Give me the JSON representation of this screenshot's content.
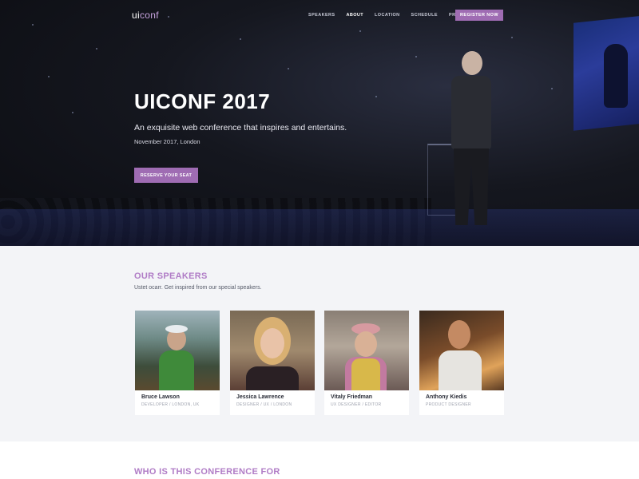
{
  "brand": {
    "prefix": "ui",
    "suffix": "conf"
  },
  "nav": {
    "items": [
      {
        "label": "SPEAKERS",
        "active": false
      },
      {
        "label": "ABOUT",
        "active": true
      },
      {
        "label": "LOCATION",
        "active": false
      },
      {
        "label": "SCHEDULE",
        "active": false
      },
      {
        "label": "PRICING",
        "active": false
      }
    ],
    "register_label": "REGISTER NOW"
  },
  "hero": {
    "title": "UICONF 2017",
    "tagline": "An exquisite web conference that inspires and entertains.",
    "date": "November 2017, London",
    "cta_label": "RESERVE YOUR SEAT"
  },
  "speakers_section": {
    "title": "OUR SPEAKERS",
    "subtitle": "Ustet ocarr. Get inspired from our special speakers.",
    "speakers": [
      {
        "name": "Bruce Lawson",
        "role": "DEVELOPER / LONDON, UK"
      },
      {
        "name": "Jessica Lawrence",
        "role": "DESIGNER / UX / LONDON"
      },
      {
        "name": "Vitaly Friedman",
        "role": "UX DESIGNER / EDITOR"
      },
      {
        "name": "Anthony Kiedis",
        "role": "PRODUCT DESIGNER"
      }
    ]
  },
  "who_section": {
    "title": "WHO IS THIS CONFERENCE FOR"
  },
  "colors": {
    "accent": "#9f6cb3",
    "section_heading": "#b07cc6",
    "hero_bg": "#15171f"
  }
}
